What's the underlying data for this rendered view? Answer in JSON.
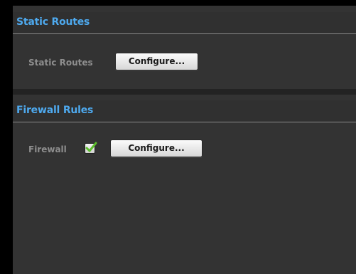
{
  "static_routes": {
    "section_title": "Static Routes",
    "row_label": "Static Routes",
    "configure_label": "Configure..."
  },
  "firewall_rules": {
    "section_title": "Firewall Rules",
    "row_label": "Firewall",
    "enabled": true,
    "configure_label": "Configure..."
  },
  "colors": {
    "header_text": "#4ea9ee",
    "panel_bg": "#333333",
    "check": "#5bbd2b"
  },
  "icons": {
    "firewall_checkbox": "checkmark-icon"
  }
}
